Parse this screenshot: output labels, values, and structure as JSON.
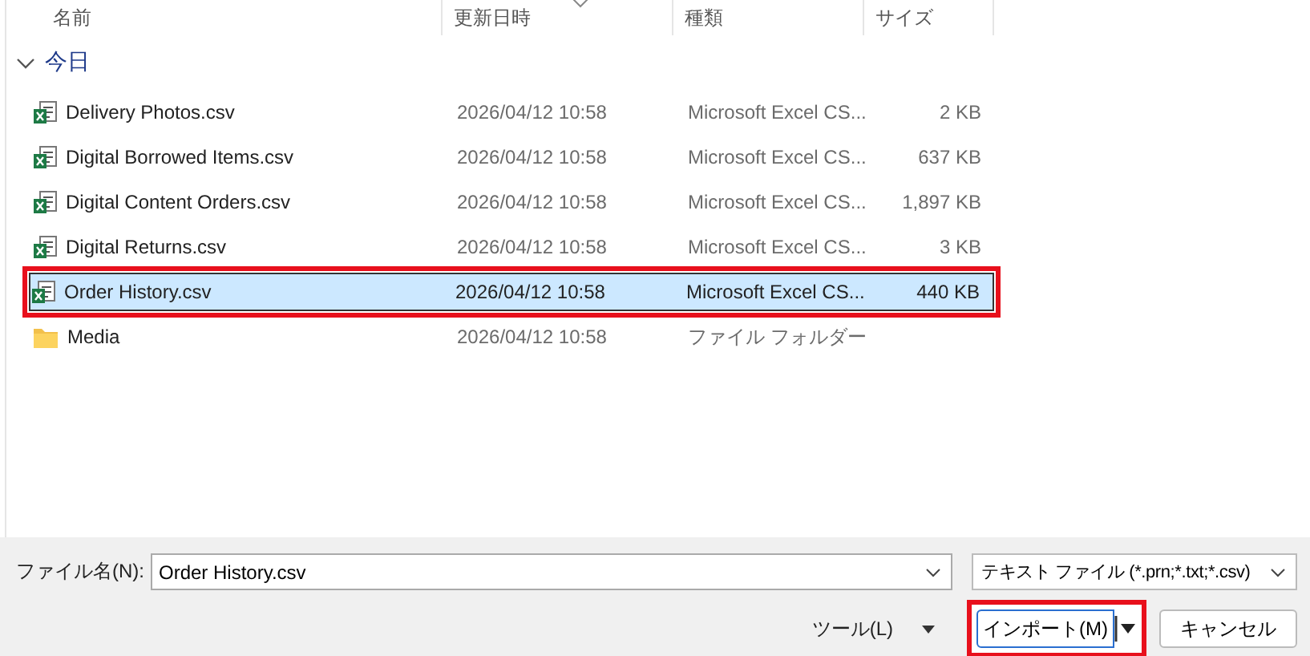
{
  "columns": [
    "名前",
    "更新日時",
    "種類",
    "サイズ"
  ],
  "group": {
    "label": "今日",
    "expanded": true
  },
  "files": [
    {
      "kind": "csv",
      "name": "Delivery Photos.csv",
      "date": "2026/04/12 10:58",
      "type": "Microsoft Excel CS...",
      "size": "2 KB",
      "selected": false,
      "highlighted": false
    },
    {
      "kind": "csv",
      "name": "Digital Borrowed Items.csv",
      "date": "2026/04/12 10:58",
      "type": "Microsoft Excel CS...",
      "size": "637 KB",
      "selected": false,
      "highlighted": false
    },
    {
      "kind": "csv",
      "name": "Digital Content Orders.csv",
      "date": "2026/04/12 10:58",
      "type": "Microsoft Excel CS...",
      "size": "1,897 KB",
      "selected": false,
      "highlighted": false
    },
    {
      "kind": "csv",
      "name": "Digital Returns.csv",
      "date": "2026/04/12 10:58",
      "type": "Microsoft Excel CS...",
      "size": "3 KB",
      "selected": false,
      "highlighted": false
    },
    {
      "kind": "csv",
      "name": "Order History.csv",
      "date": "2026/04/12 10:58",
      "type": "Microsoft Excel CS...",
      "size": "440 KB",
      "selected": true,
      "highlighted": true
    },
    {
      "kind": "folder",
      "name": "Media",
      "date": "2026/04/12 10:58",
      "type": "ファイル フォルダー",
      "selected": false,
      "highlighted": false
    }
  ],
  "filename": {
    "label": "ファイル名(N):",
    "value": "Order History.csv"
  },
  "filter": {
    "value": "テキスト ファイル (*.prn;*.txt;*.csv)"
  },
  "tools": {
    "label": "ツール(L)"
  },
  "import_button": {
    "label": "インポート(M)",
    "highlighted": true
  },
  "cancel_button": {
    "label": "キャンセル"
  }
}
